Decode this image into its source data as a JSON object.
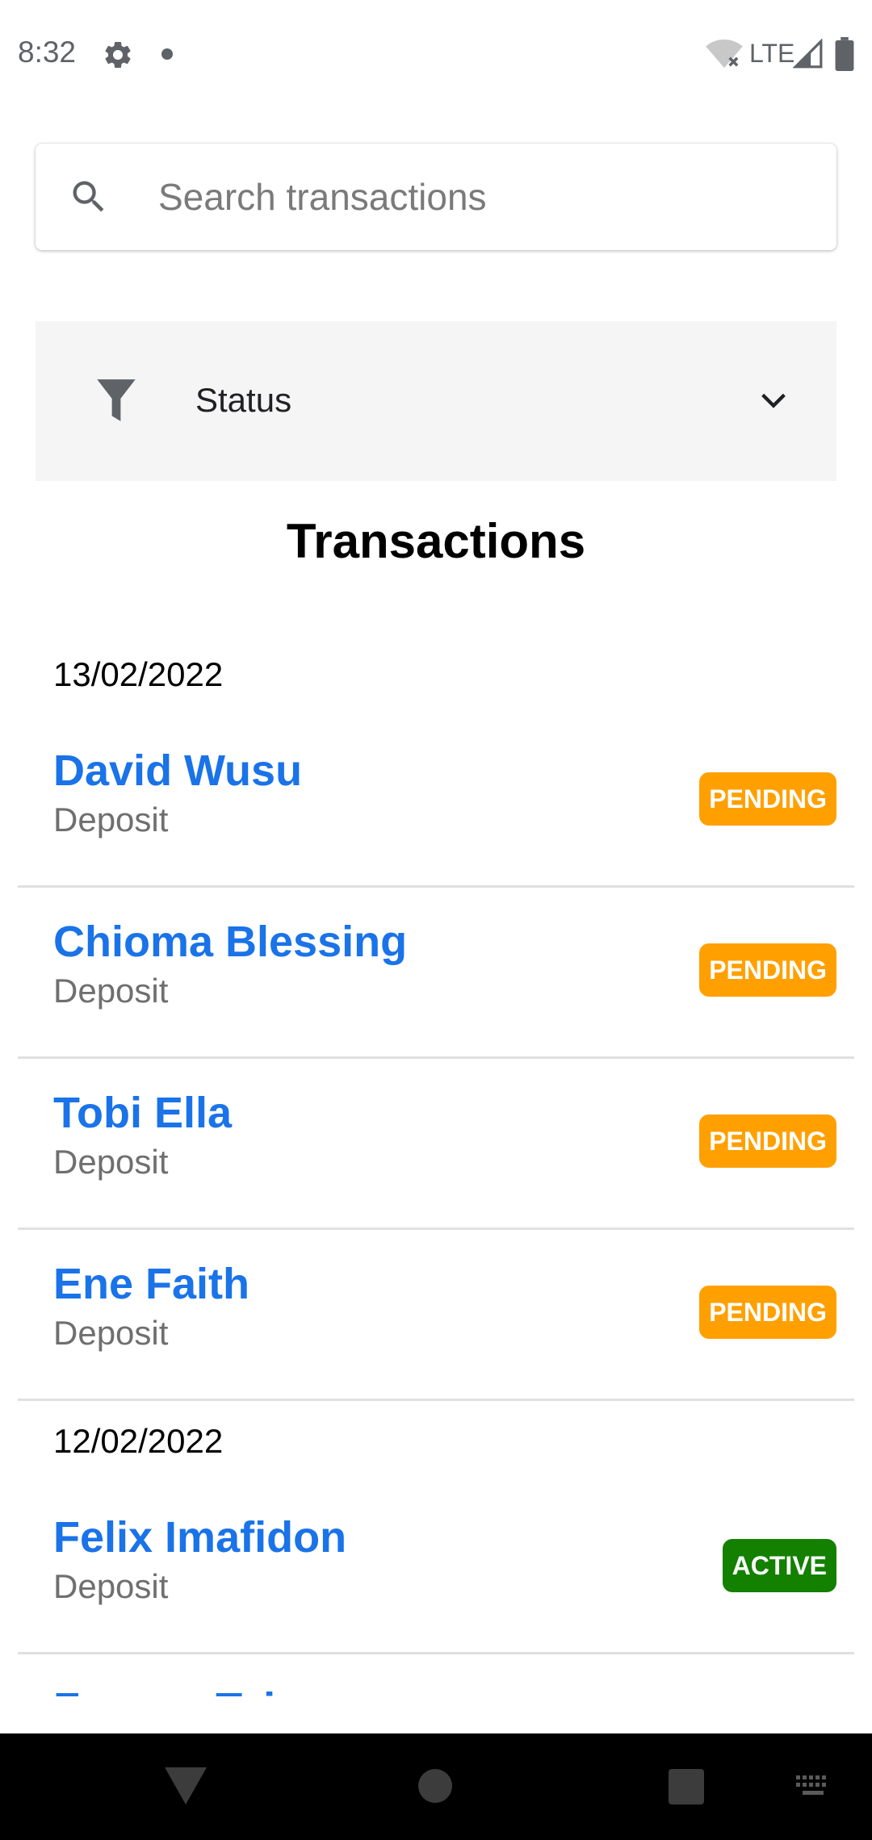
{
  "status_bar": {
    "time": "8:32",
    "network": "LTE",
    "icons": [
      "gear-icon",
      "notification-dot-icon",
      "wifi-off-icon",
      "signal-icon",
      "battery-icon"
    ]
  },
  "search": {
    "placeholder": "Search transactions",
    "value": ""
  },
  "filter": {
    "label": "Status"
  },
  "title": "Transactions",
  "groups": [
    {
      "date": "13/02/2022",
      "items": [
        {
          "name": "David Wusu",
          "type": "Deposit",
          "status": "PENDING"
        },
        {
          "name": "Chioma Blessing",
          "type": "Deposit",
          "status": "PENDING"
        },
        {
          "name": "Tobi Ella",
          "type": "Deposit",
          "status": "PENDING"
        },
        {
          "name": "Ene Faith",
          "type": "Deposit",
          "status": "PENDING"
        }
      ]
    },
    {
      "date": "12/02/2022",
      "items": [
        {
          "name": "Felix Imafidon",
          "type": "Deposit",
          "status": "ACTIVE"
        },
        {
          "name": "Farawe Taiwo",
          "type": "",
          "status": ""
        }
      ]
    }
  ],
  "colors": {
    "name_link": "#1a73e8",
    "pending": "#ffa000",
    "active": "#138000",
    "filter_bg": "#f5f5f5",
    "divider": "#e0e0e0"
  }
}
